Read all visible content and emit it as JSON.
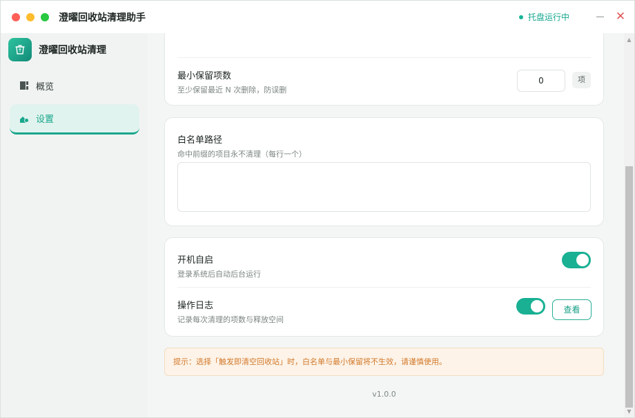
{
  "window": {
    "title": "澄曜回收站清理助手",
    "tray_status": "托盘运行中"
  },
  "sidebar": {
    "brand": "澄曜回收站清理",
    "items": [
      {
        "label": "概览",
        "icon": "overview-icon",
        "active": false
      },
      {
        "label": "设置",
        "icon": "settings-icon",
        "active": true
      }
    ]
  },
  "settings": {
    "min_keep": {
      "title": "最小保留项数",
      "subtitle": "至少保留最近 N 次删除，防误删",
      "value": "0",
      "unit": "项"
    },
    "whitelist": {
      "title": "白名单路径",
      "subtitle": "命中前缀的项目永不清理（每行一个）",
      "value": ""
    },
    "autostart": {
      "title": "开机自启",
      "subtitle": "登录系统后自动后台运行",
      "enabled": true
    },
    "log": {
      "title": "操作日志",
      "subtitle": "记录每次清理的项数与释放空间",
      "enabled": true,
      "view_label": "查看"
    }
  },
  "notice": "提示：选择「触发即清空回收站」时，白名单与最小保留将不生效，请谨慎使用。",
  "version": "v1.0.0",
  "colors": {
    "accent": "#19b094",
    "notice_text": "#d2792a",
    "notice_bg": "#fdf3e8",
    "close": "#e25757"
  }
}
